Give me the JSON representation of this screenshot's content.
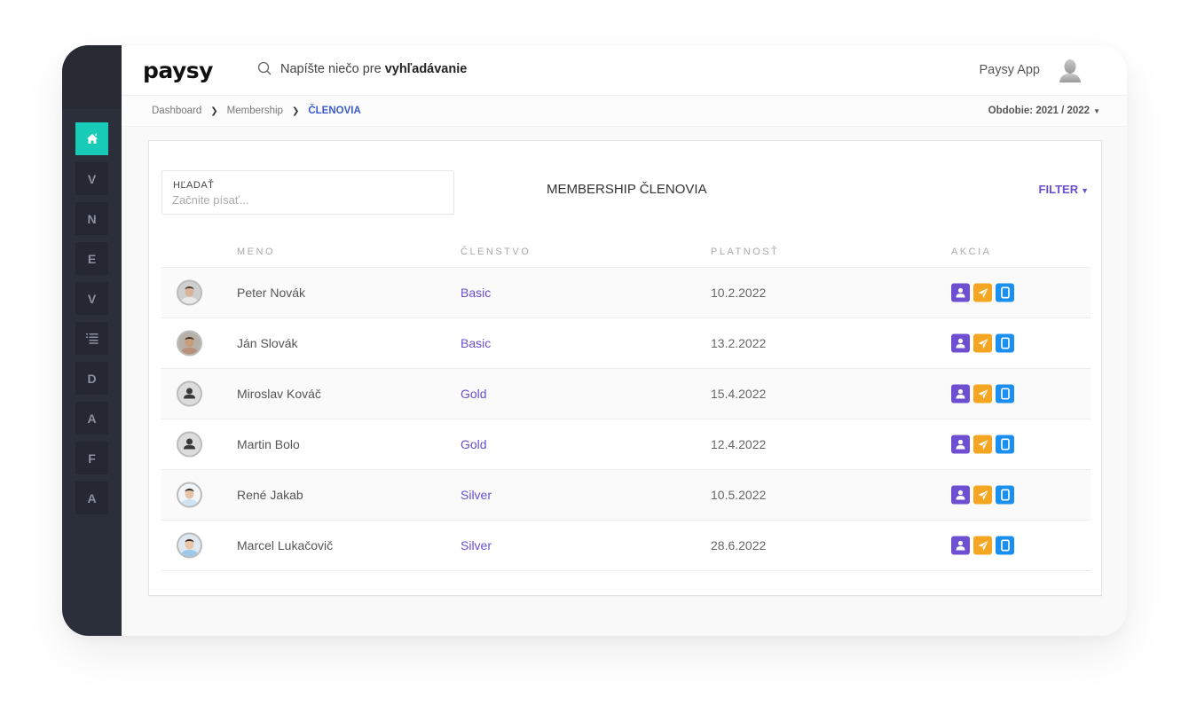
{
  "app": {
    "logo": "paysy",
    "search_prefix": "Napíšte niečo pre ",
    "search_bold": "vyhľadávanie",
    "user_name": "Paysy App"
  },
  "breadcrumb": {
    "items": [
      "Dashboard",
      "Membership"
    ],
    "current": "ČLENOVIA"
  },
  "period": {
    "label": "Obdobie: 2021 / 2022"
  },
  "sidebar": {
    "items": [
      {
        "label": "",
        "icon": "home-icon",
        "active": true
      },
      {
        "label": "V"
      },
      {
        "label": "N"
      },
      {
        "label": "E"
      },
      {
        "label": "V"
      },
      {
        "label": "",
        "icon": "list-icon"
      },
      {
        "label": "D"
      },
      {
        "label": "A"
      },
      {
        "label": "F"
      },
      {
        "label": "A"
      }
    ]
  },
  "card": {
    "search_label": "HĽADAŤ",
    "search_placeholder": "Začnite písať...",
    "title": "MEMBERSHIP ČLENOVIA",
    "filter_label": "FILTER"
  },
  "table": {
    "headers": [
      "MENO",
      "ČLENSTVO",
      "PLATNOSŤ",
      "AKCIA"
    ],
    "rows": [
      {
        "name": "Peter Novák",
        "tier": "Basic",
        "valid": "10.2.2022",
        "avatar": "photo"
      },
      {
        "name": "Ján Slovák",
        "tier": "Basic",
        "valid": "13.2.2022",
        "avatar": "photo"
      },
      {
        "name": "Miroslav Kováč",
        "tier": "Gold",
        "valid": "15.4.2022",
        "avatar": "placeholder"
      },
      {
        "name": "Martin Bolo",
        "tier": "Gold",
        "valid": "12.4.2022",
        "avatar": "placeholder"
      },
      {
        "name": "René Jakab",
        "tier": "Silver",
        "valid": "10.5.2022",
        "avatar": "photo"
      },
      {
        "name": "Marcel Lukačovič",
        "tier": "Silver",
        "valid": "28.6.2022",
        "avatar": "photo"
      }
    ],
    "actions": [
      "profile-icon",
      "send-icon",
      "device-icon"
    ]
  },
  "colors": {
    "accent_teal": "#17cbb8",
    "purple": "#6e4fd2",
    "orange": "#f4a623",
    "blue": "#1a8ff0",
    "sidebar": "#2b2f3a"
  }
}
